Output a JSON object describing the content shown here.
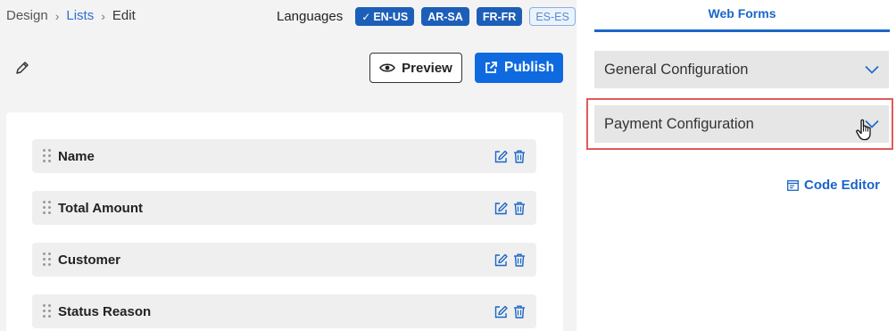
{
  "breadcrumb": {
    "items": [
      {
        "label": "Design"
      },
      {
        "label": "Lists"
      },
      {
        "label": "Edit"
      }
    ]
  },
  "languages": {
    "label": "Languages",
    "chips": [
      {
        "label": "EN-US",
        "selected": true,
        "checked": true
      },
      {
        "label": "AR-SA",
        "selected": true,
        "checked": false
      },
      {
        "label": "FR-FR",
        "selected": true,
        "checked": false
      },
      {
        "label": "ES-ES",
        "selected": false,
        "checked": false
      }
    ]
  },
  "toolbar": {
    "preview_label": "Preview",
    "publish_label": "Publish"
  },
  "fields": [
    {
      "name": "Name"
    },
    {
      "name": "Total Amount"
    },
    {
      "name": "Customer"
    },
    {
      "name": "Status Reason"
    }
  ],
  "sidebar": {
    "tab_label": "Web Forms",
    "sections": [
      {
        "label": "General Configuration"
      },
      {
        "label": "Payment Configuration"
      }
    ],
    "code_editor_label": "Code Editor"
  },
  "colors": {
    "accent": "#0f6ae0",
    "highlight": "#e15a5a"
  }
}
